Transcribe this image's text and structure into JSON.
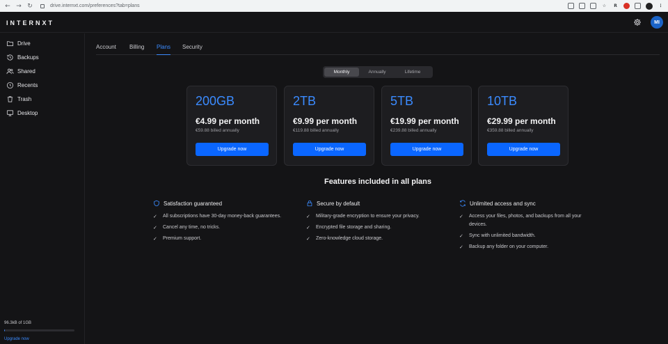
{
  "browser": {
    "url": "drive.internxt.com/preferences?tab=plans",
    "ext_letter": "R"
  },
  "app": {
    "logo": "INTERNXT",
    "avatar_initials": "MI"
  },
  "sidebar": {
    "items": [
      {
        "label": "Drive",
        "icon": "folder-icon"
      },
      {
        "label": "Backups",
        "icon": "history-icon"
      },
      {
        "label": "Shared",
        "icon": "users-icon"
      },
      {
        "label": "Recents",
        "icon": "clock-icon"
      },
      {
        "label": "Trash",
        "icon": "trash-icon"
      },
      {
        "label": "Desktop",
        "icon": "desktop-icon"
      }
    ],
    "storage_text": "96.3kB of 1GB",
    "storage_used_fraction": 0.01,
    "upgrade_label": "Upgrade now"
  },
  "tabs": [
    {
      "label": "Account"
    },
    {
      "label": "Billing"
    },
    {
      "label": "Plans",
      "active": true
    },
    {
      "label": "Security"
    }
  ],
  "period": {
    "options": [
      "Monthly",
      "Annually",
      "Lifetime"
    ],
    "selected": "Monthly"
  },
  "plans": [
    {
      "size": "200GB",
      "price": "€4.99 per month",
      "billed": "€59.88 billed annually",
      "button": "Upgrade now"
    },
    {
      "size": "2TB",
      "price": "€9.99 per month",
      "billed": "€119.88 billed annually",
      "button": "Upgrade now"
    },
    {
      "size": "5TB",
      "price": "€19.99 per month",
      "billed": "€239.88 billed annually",
      "button": "Upgrade now"
    },
    {
      "size": "10TB",
      "price": "€29.99 per month",
      "billed": "€359.88 billed annually",
      "button": "Upgrade now"
    }
  ],
  "features": {
    "title": "Features included in all plans",
    "columns": [
      {
        "heading": "Satisfaction guaranteed",
        "icon": "shield-icon",
        "items": [
          "All subscriptions have 30-day money-back guarantees.",
          "Cancel any time, no tricks.",
          "Premium support."
        ]
      },
      {
        "heading": "Secure by default",
        "icon": "lock-icon",
        "items": [
          "Military-grade encryption to ensure your privacy.",
          "Encrypted file storage and sharing.",
          "Zero-knowledge cloud storage."
        ]
      },
      {
        "heading": "Unlimited access and sync",
        "icon": "sync-icon",
        "items": [
          "Access your files, photos, and backups from all your devices.",
          "Sync with unlimited bandwidth.",
          "Backup any folder on your computer."
        ]
      }
    ]
  },
  "colors": {
    "accent": "#3b8bff",
    "button": "#0a66ff",
    "background": "#141416",
    "card": "#1d1d20"
  }
}
